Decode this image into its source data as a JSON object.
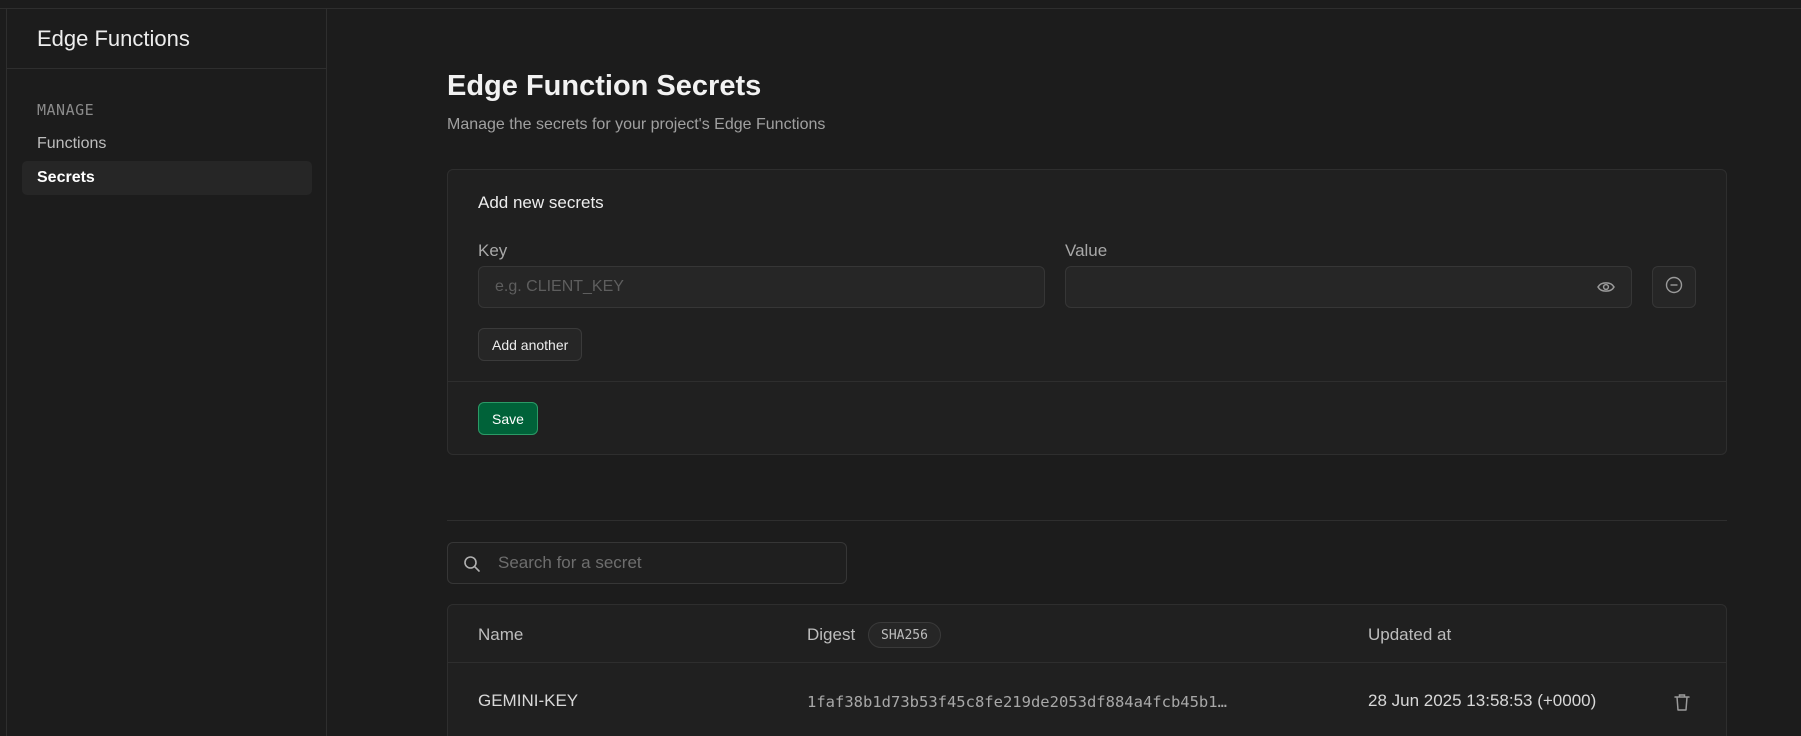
{
  "sidebar": {
    "title": "Edge Functions",
    "section_label": "MANAGE",
    "items": [
      {
        "label": "Functions",
        "active": false
      },
      {
        "label": "Secrets",
        "active": true
      }
    ]
  },
  "main": {
    "title": "Edge Function Secrets",
    "subtitle": "Manage the secrets for your project's Edge Functions",
    "add_card": {
      "title": "Add new secrets",
      "key_label": "Key",
      "key_placeholder": "e.g. CLIENT_KEY",
      "key_value": "",
      "value_label": "Value",
      "value_value": "",
      "add_another_label": "Add another",
      "save_label": "Save"
    },
    "search": {
      "placeholder": "Search for a secret"
    },
    "table": {
      "headers": {
        "name": "Name",
        "digest": "Digest",
        "digest_badge": "SHA256",
        "updated": "Updated at"
      },
      "rows": [
        {
          "name": "GEMINI-KEY",
          "digest": "1faf38b1d73b53f45c8fe219de2053df884a4fcb45b1…",
          "updated": "28 Jun 2025 13:58:53 (+0000)"
        }
      ]
    }
  },
  "colors": {
    "background": "#1c1c1c",
    "accent": "#006239",
    "accent_border": "#2b9a66"
  },
  "icons": [
    "eye-icon",
    "minus-circle-icon",
    "search-icon",
    "trash-icon"
  ]
}
